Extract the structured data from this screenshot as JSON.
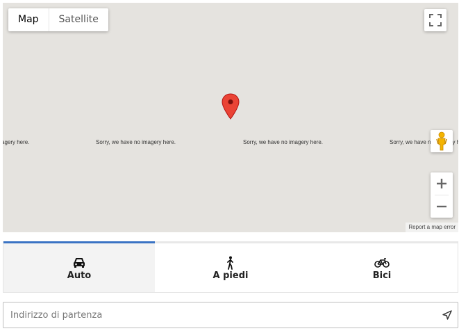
{
  "map": {
    "type_control": {
      "map_label": "Map",
      "satellite_label": "Satellite"
    },
    "no_imagery_text": "Sorry, we have no imagery here.",
    "no_imagery_fragment": "agery here.",
    "report_link": "Report a map error"
  },
  "travel_modes": [
    {
      "label": "Auto",
      "icon": "car-icon"
    },
    {
      "label": "A piedi",
      "icon": "walk-icon"
    },
    {
      "label": "Bici",
      "icon": "bicycle-icon"
    }
  ],
  "address": {
    "placeholder": "Indirizzo di partenza",
    "value": ""
  },
  "colors": {
    "active_tab_border": "#3a73c4",
    "marker": "#ea4335",
    "map_background": "#e5e3df"
  }
}
